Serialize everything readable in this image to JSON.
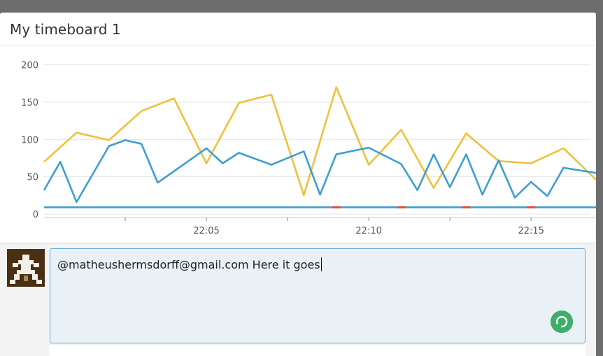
{
  "panel": {
    "title": "My timeboard 1"
  },
  "chart_data": {
    "type": "line",
    "ylim": [
      0,
      210
    ],
    "yticks": [
      0,
      50,
      100,
      150,
      200
    ],
    "xrange": [
      "22:00",
      "22:17"
    ],
    "xticks": [
      {
        "label": "22:05",
        "t": 5
      },
      {
        "label": "22:10",
        "t": 10
      },
      {
        "label": "22:15",
        "t": 15
      }
    ],
    "x": [
      0,
      0.5,
      1,
      2,
      2.5,
      3,
      3.5,
      5,
      5.5,
      6,
      7,
      8,
      8.5,
      9,
      10,
      11,
      11.5,
      12,
      12.5,
      13,
      13.5,
      14,
      14.5,
      15,
      15.5,
      16,
      16.5,
      17
    ],
    "series": [
      {
        "color": "#f0c13a",
        "points": [
          [
            0,
            70
          ],
          [
            1,
            109
          ],
          [
            2,
            99
          ],
          [
            3,
            138
          ],
          [
            4,
            155
          ],
          [
            5,
            68
          ],
          [
            6,
            149
          ],
          [
            7,
            160
          ],
          [
            8,
            25
          ],
          [
            9,
            170
          ],
          [
            10,
            66
          ],
          [
            11,
            113
          ],
          [
            12,
            35
          ],
          [
            13,
            108
          ],
          [
            14,
            71
          ],
          [
            15,
            68
          ],
          [
            16,
            88
          ],
          [
            17,
            46
          ]
        ]
      },
      {
        "color": "#3d9fd1",
        "points": [
          [
            0,
            32
          ],
          [
            0.5,
            70
          ],
          [
            1,
            16
          ],
          [
            2,
            91
          ],
          [
            2.5,
            99
          ],
          [
            3,
            94
          ],
          [
            3.5,
            42
          ],
          [
            5,
            88
          ],
          [
            5.5,
            68
          ],
          [
            6,
            82
          ],
          [
            7,
            66
          ],
          [
            8,
            84
          ],
          [
            8.5,
            26
          ],
          [
            9,
            80
          ],
          [
            10,
            89
          ],
          [
            11,
            67
          ],
          [
            11.5,
            32
          ],
          [
            12,
            80
          ],
          [
            12.5,
            36
          ],
          [
            13,
            80
          ],
          [
            13.5,
            26
          ],
          [
            14,
            72
          ],
          [
            14.5,
            22
          ],
          [
            15,
            43
          ],
          [
            15.5,
            24
          ],
          [
            16,
            62
          ],
          [
            17,
            55
          ]
        ]
      },
      {
        "color": "#3d9fd1",
        "points": [
          [
            0,
            9
          ],
          [
            17,
            9
          ]
        ]
      }
    ],
    "markers": [
      {
        "t": 9,
        "color": "#e64b3c"
      },
      {
        "t": 11,
        "color": "#e64b3c"
      },
      {
        "t": 13,
        "color": "#e64b3c"
      },
      {
        "t": 15,
        "color": "#e64b3c"
      }
    ]
  },
  "comment": {
    "text": "@matheushermsdorff@gmail.com Here it goes",
    "accent": "#5fa8d7",
    "send_color": "#3fae6a"
  },
  "icons": {
    "avatar": "pixel-avatar-icon",
    "send": "refresh-send-icon"
  }
}
